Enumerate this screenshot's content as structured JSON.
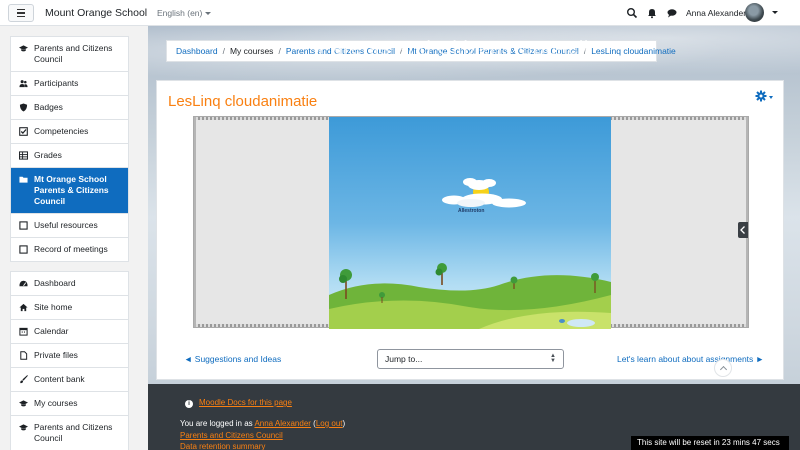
{
  "navbar": {
    "site_name": "Mount Orange School",
    "language": "English (en)",
    "user_name": "Anna Alexander"
  },
  "header": {
    "title": "Parents and Citizens Council"
  },
  "sidebar": {
    "course_items": [
      {
        "label": "Parents and Citizens Council",
        "icon": "graduation-cap-icon"
      },
      {
        "label": "Participants",
        "icon": "users-icon"
      },
      {
        "label": "Badges",
        "icon": "shield-icon"
      },
      {
        "label": "Competencies",
        "icon": "check-square-icon"
      },
      {
        "label": "Grades",
        "icon": "table-icon"
      },
      {
        "label": "Mt Orange School Parents & Citizens Council",
        "icon": "folder-icon",
        "active": true
      },
      {
        "label": "Useful resources",
        "icon": "square-icon"
      },
      {
        "label": "Record of meetings",
        "icon": "square-icon"
      }
    ],
    "site_items": [
      {
        "label": "Dashboard",
        "icon": "dashboard-icon"
      },
      {
        "label": "Site home",
        "icon": "home-icon"
      },
      {
        "label": "Calendar",
        "icon": "calendar-icon"
      },
      {
        "label": "Private files",
        "icon": "file-icon"
      },
      {
        "label": "Content bank",
        "icon": "paintbrush-icon"
      },
      {
        "label": "My courses",
        "icon": "graduation-cap-icon"
      },
      {
        "label": "Parents and Citizens Council",
        "icon": "graduation-cap-icon"
      }
    ]
  },
  "breadcrumb": [
    "Dashboard",
    "My courses",
    "Parents and Citizens Council",
    "Mt Orange School Parents & Citizens Council",
    "LesLinq cloudanimatie"
  ],
  "main": {
    "title": "LesLinq cloudanimatie",
    "animation_label": "Allestroton",
    "prev_link": "◄ Suggestions and Ideas",
    "jump_label": "Jump to...",
    "next_link": "Let's learn about about assignments ►"
  },
  "footer": {
    "docs_link": "Moodle Docs for this page",
    "logged_in_prefix": "You are logged in as ",
    "logged_in_user": "Anna Alexander",
    "logout_open": " (",
    "logout_label": "Log out",
    "logout_close": ")",
    "course_link": "Parents and Citizens Council",
    "data_link": "Data retention summary"
  },
  "reset_banner": "This site will be reset in 23 mins 47 secs",
  "colors": {
    "brand_blue": "#0f6cbf",
    "accent_orange": "#f98012",
    "footer_bg": "#343a40"
  }
}
